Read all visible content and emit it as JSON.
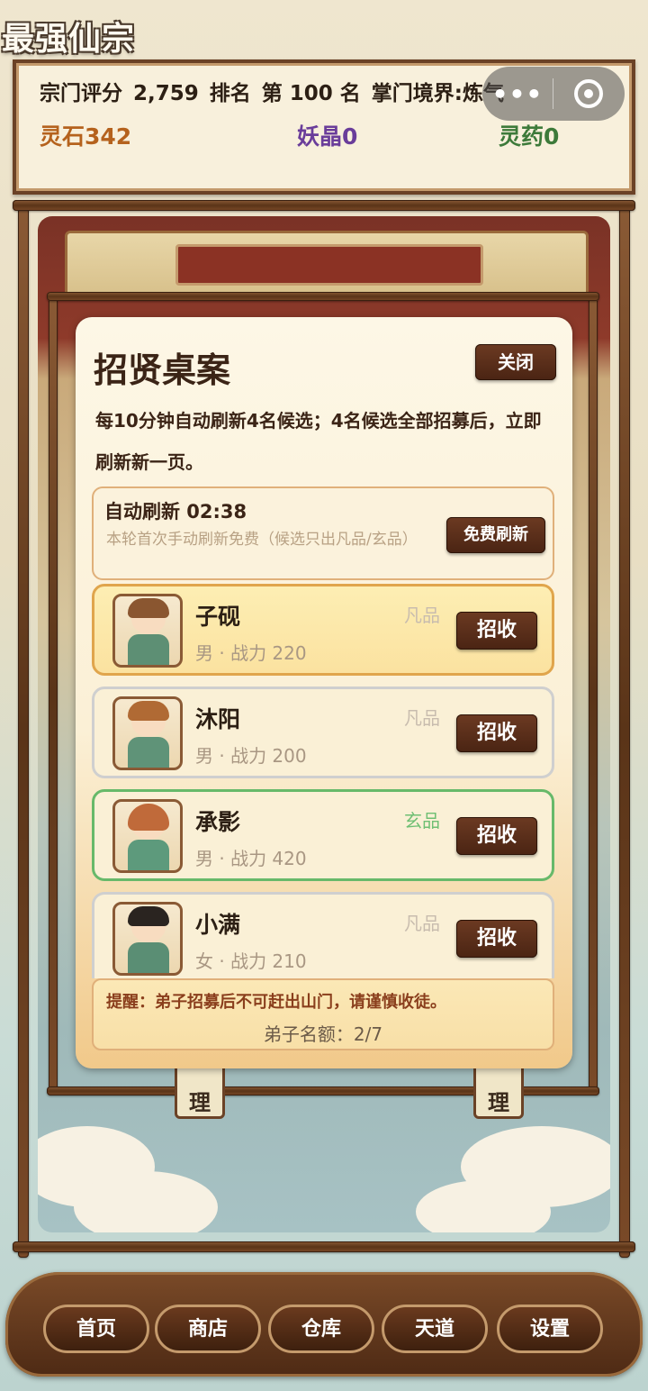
{
  "app": {
    "title": "最强仙宗"
  },
  "status": {
    "score_label": "宗门评分",
    "score": "2,759",
    "rank_label": "排名",
    "rank": "第 100 名",
    "realm": "掌门境界:炼气",
    "lingshi": "灵石342",
    "yaojing": "妖晶0",
    "lingyao": "灵药0"
  },
  "capsule": {
    "menu_icon": "more-dots-icon",
    "close_icon": "target-circle-icon"
  },
  "scene": {
    "left_tag": "理",
    "right_tag": "理"
  },
  "dialog": {
    "title": "招贤桌案",
    "close_label": "关闭",
    "description": "每10分钟自动刷新4名候选；4名候选全部招募后，立即刷新新一页。",
    "refresh": {
      "title": "自动刷新 02:38",
      "note": "本轮首次手动刷新免费（候选只出凡品/玄品）",
      "button": "免费刷新"
    },
    "candidates": [
      {
        "name": "子砚",
        "meta": "男 · 战力 220",
        "grade": "凡品",
        "button": "招收"
      },
      {
        "name": "沐阳",
        "meta": "男 · 战力 200",
        "grade": "凡品",
        "button": "招收"
      },
      {
        "name": "承影",
        "meta": "男 · 战力 420",
        "grade": "玄品",
        "button": "招收"
      },
      {
        "name": "小满",
        "meta": "女 · 战力 210",
        "grade": "凡品",
        "button": "招收"
      }
    ],
    "reminder": "提醒：弟子招募后不可赶出山门，请谨慎收徒。",
    "quota": "弟子名额：2/7"
  },
  "nav": [
    "首页",
    "商店",
    "仓库",
    "天道",
    "设置"
  ],
  "colors": {
    "lingshi": "#b5621d",
    "yaojing": "#6a3d9a",
    "lingyao": "#3d7a3a",
    "xuan_grade": "#6fbf73",
    "fan_grade": "#c8bcae"
  }
}
